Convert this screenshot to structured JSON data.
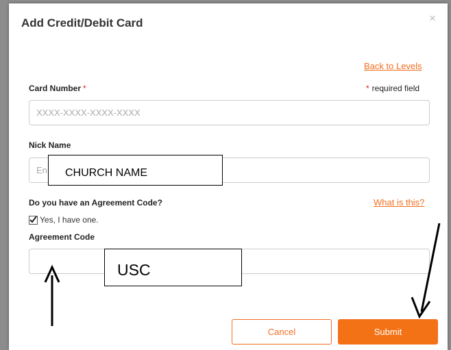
{
  "dialog": {
    "title": "Add Credit/Debit Card",
    "close_glyph": "×",
    "back_link": "Back to Levels",
    "required_note": "required field",
    "required_star": "*"
  },
  "card_number": {
    "label": "Card Number",
    "placeholder": "XXXX-XXXX-XXXX-XXXX",
    "value": ""
  },
  "nick_name": {
    "label": "Nick Name",
    "placeholder": "En",
    "value": ""
  },
  "agreement": {
    "question": "Do you have an Agreement Code?",
    "help_link": "What is this?",
    "checkbox_label": "Yes, I have one.",
    "checked": true,
    "code_label": "Agreement Code",
    "code_value": ""
  },
  "annotations": {
    "nick_name_overlay": "CHURCH NAME",
    "agreement_overlay": "USC"
  },
  "buttons": {
    "cancel": "Cancel",
    "submit": "Submit"
  },
  "colors": {
    "accent": "#f47216",
    "required": "#e02020"
  }
}
